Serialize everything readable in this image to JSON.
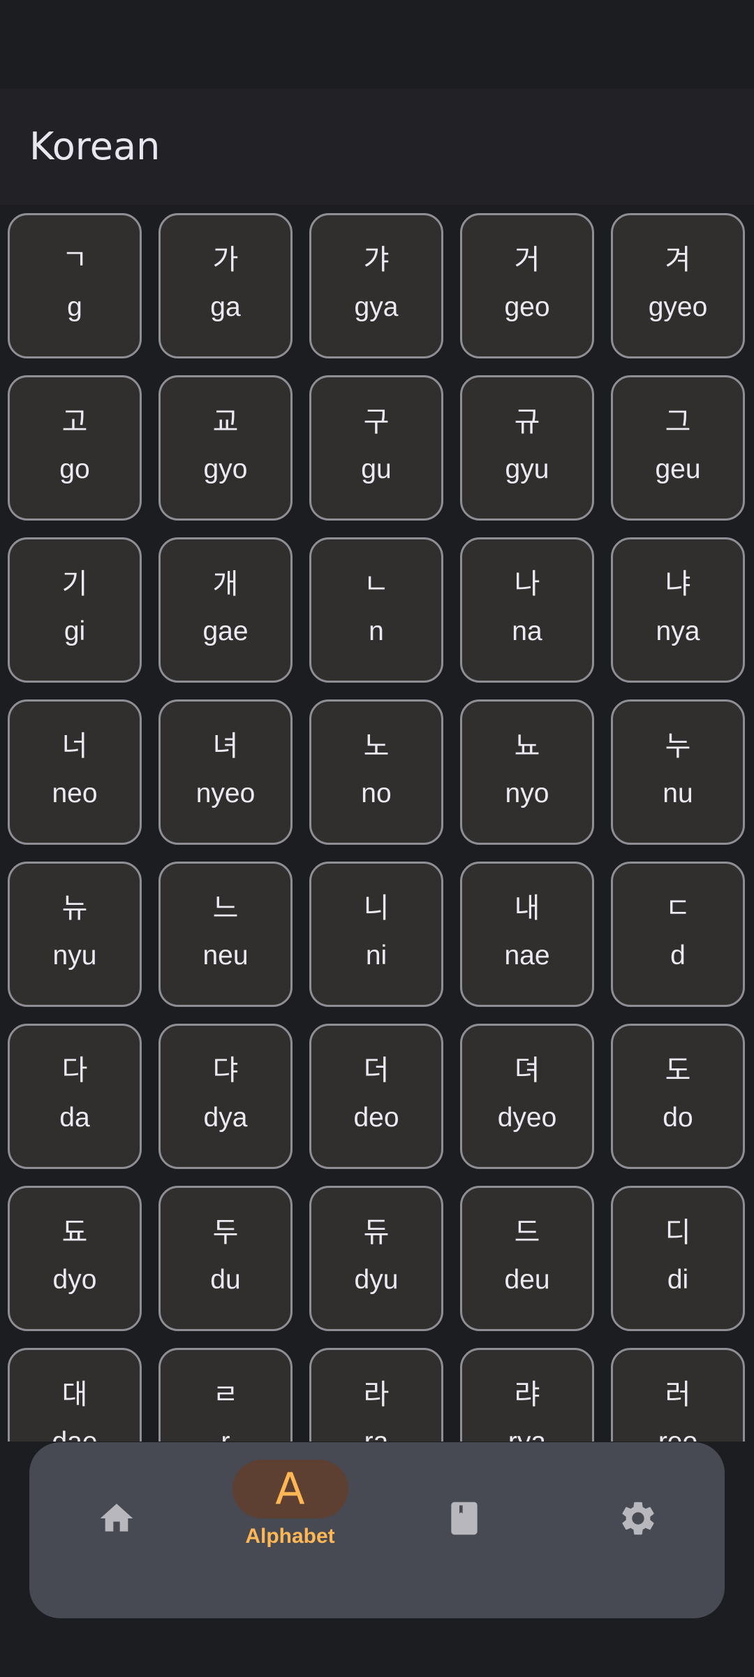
{
  "app": {
    "title": "Korean"
  },
  "letters": [
    {
      "hangul": "ㄱ",
      "roman": "g"
    },
    {
      "hangul": "가",
      "roman": "ga"
    },
    {
      "hangul": "갸",
      "roman": "gya"
    },
    {
      "hangul": "거",
      "roman": "geo"
    },
    {
      "hangul": "겨",
      "roman": "gyeo"
    },
    {
      "hangul": "고",
      "roman": "go"
    },
    {
      "hangul": "교",
      "roman": "gyo"
    },
    {
      "hangul": "구",
      "roman": "gu"
    },
    {
      "hangul": "규",
      "roman": "gyu"
    },
    {
      "hangul": "그",
      "roman": "geu"
    },
    {
      "hangul": "기",
      "roman": "gi"
    },
    {
      "hangul": "개",
      "roman": "gae"
    },
    {
      "hangul": "ㄴ",
      "roman": "n"
    },
    {
      "hangul": "나",
      "roman": "na"
    },
    {
      "hangul": "냐",
      "roman": "nya"
    },
    {
      "hangul": "너",
      "roman": "neo"
    },
    {
      "hangul": "녀",
      "roman": "nyeo"
    },
    {
      "hangul": "노",
      "roman": "no"
    },
    {
      "hangul": "뇨",
      "roman": "nyo"
    },
    {
      "hangul": "누",
      "roman": "nu"
    },
    {
      "hangul": "뉴",
      "roman": "nyu"
    },
    {
      "hangul": "느",
      "roman": "neu"
    },
    {
      "hangul": "니",
      "roman": "ni"
    },
    {
      "hangul": "내",
      "roman": "nae"
    },
    {
      "hangul": "ㄷ",
      "roman": "d"
    },
    {
      "hangul": "다",
      "roman": "da"
    },
    {
      "hangul": "댜",
      "roman": "dya"
    },
    {
      "hangul": "더",
      "roman": "deo"
    },
    {
      "hangul": "뎌",
      "roman": "dyeo"
    },
    {
      "hangul": "도",
      "roman": "do"
    },
    {
      "hangul": "됴",
      "roman": "dyo"
    },
    {
      "hangul": "두",
      "roman": "du"
    },
    {
      "hangul": "듀",
      "roman": "dyu"
    },
    {
      "hangul": "드",
      "roman": "deu"
    },
    {
      "hangul": "디",
      "roman": "di"
    },
    {
      "hangul": "대",
      "roman": "dae"
    },
    {
      "hangul": "ㄹ",
      "roman": "r"
    },
    {
      "hangul": "라",
      "roman": "ra"
    },
    {
      "hangul": "랴",
      "roman": "rya"
    },
    {
      "hangul": "러",
      "roman": "reo"
    }
  ],
  "nav": {
    "items": [
      {
        "icon": "home-icon",
        "label": "",
        "selected": false
      },
      {
        "icon": "alphabet-icon",
        "glyph": "A",
        "label": "Alphabet",
        "selected": true
      },
      {
        "icon": "book-icon",
        "label": "",
        "selected": false
      },
      {
        "icon": "settings-icon",
        "label": "",
        "selected": false
      }
    ],
    "accent_color": "#ffb654",
    "pill_color": "#5e4033",
    "icon_color": "#b7b7bd"
  }
}
